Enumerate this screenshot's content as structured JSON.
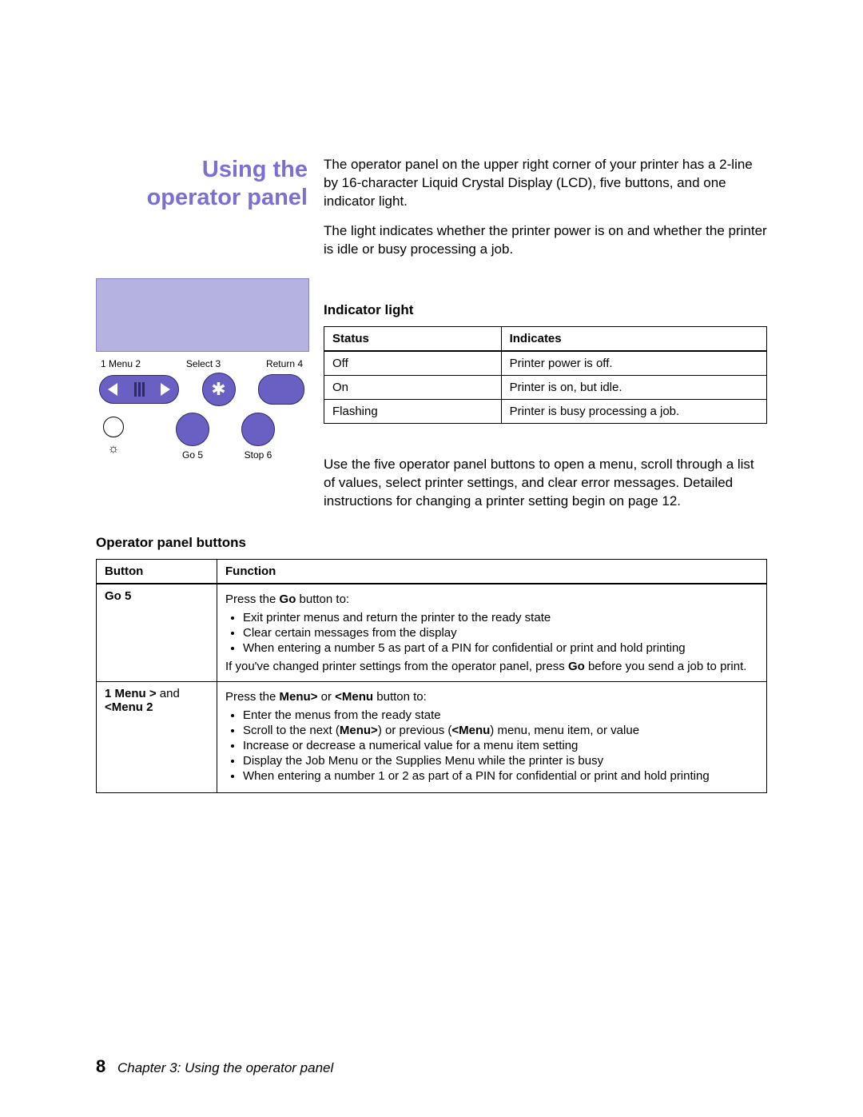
{
  "title_line1": "Using the",
  "title_line2": "operator panel",
  "intro_p1": "The operator panel on the upper right corner of your printer has a 2-line by 16-character Liquid Crystal Display (LCD), five buttons, and one indicator light.",
  "intro_p2": "The light indicates whether the printer power is on and whether the printer is idle or busy processing a job.",
  "diagram": {
    "label_menu": "1  Menu  2",
    "label_select": "Select  3",
    "label_return": "Return  4",
    "label_go": "Go  5",
    "label_stop": "Stop  6"
  },
  "indicator": {
    "heading": "Indicator light",
    "col_status": "Status",
    "col_indicates": "Indicates",
    "rows": [
      {
        "status": "Off",
        "indicates": "Printer power is off."
      },
      {
        "status": "On",
        "indicates": "Printer is on, but idle."
      },
      {
        "status": "Flashing",
        "indicates": "Printer is busy processing a job."
      }
    ]
  },
  "usage_text": "Use the five operator panel buttons to open a menu, scroll through a list of values, select printer settings, and clear error messages. Detailed instructions for changing a printer setting begin on page 12.",
  "buttons_section": {
    "heading": "Operator panel buttons",
    "col_button": "Button",
    "col_function": "Function",
    "row_go": {
      "button": "Go  5",
      "intro_a": "Press the ",
      "intro_bold": "Go",
      "intro_b": " button to:",
      "items": [
        "Exit printer menus and return the printer to the ready state",
        "Clear certain messages from the display",
        "When entering a number 5 as part of a PIN for confidential or print and hold printing"
      ],
      "tail_a": "If you've changed printer settings from the operator panel, press ",
      "tail_bold": "Go",
      "tail_b": " before you send a job to print."
    },
    "row_menu": {
      "button_line1_a": "1  Menu >",
      "button_line1_b": " and",
      "button_line2": "<Menu  2",
      "intro_a": "Press the ",
      "intro_bold1": "Menu>",
      "intro_mid": " or ",
      "intro_bold2": "<Menu",
      "intro_b": " button to:",
      "items_pre": "Enter the menus from the ready state",
      "item2_a": "Scroll to the next (",
      "item2_bold1": "Menu>",
      "item2_mid": ") or previous (",
      "item2_bold2": "<Menu",
      "item2_b": ") menu, menu item, or value",
      "items_rest": [
        "Increase or decrease a numerical value for a menu item setting",
        "Display the Job Menu or the Supplies Menu while the printer is busy",
        "When entering a number 1 or 2 as part of a PIN for confidential or print and hold printing"
      ]
    }
  },
  "footer": {
    "page": "8",
    "chapter": "Chapter 3: Using the operator panel"
  }
}
